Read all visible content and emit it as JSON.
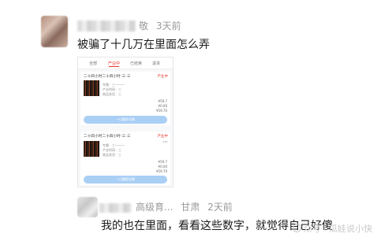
{
  "comment1": {
    "user_suffix": "敬",
    "time": "3天前",
    "text": "被骗了十几万在里面怎么弄"
  },
  "screenshot": {
    "tabs": [
      "全部",
      "产业中",
      "已结束",
      "退货"
    ],
    "orders": [
      {
        "name": "二十四小时二十四小时·三·三",
        "status": "产业中",
        "lines": [
          "专属 · 三一一一",
          "产业时间 · 三",
          "商品发货 · 三"
        ],
        "amounts": [
          "¥59.7",
          "¥0.00",
          "¥59.70"
        ],
        "track_label": "一日跟踪详情"
      },
      {
        "name": "二十四小时二十四小时·三·三",
        "status": "产业中",
        "lines": [
          "专属 · 三一一一",
          "产业时间 · 三",
          "商品发货 · 三"
        ],
        "amounts": [
          "¥59.7",
          "¥0.00",
          "¥59.70"
        ],
        "track_label": "一日跟踪详情"
      }
    ]
  },
  "comment2": {
    "user": "高级育...",
    "location": "甘肃",
    "time": "2天前",
    "text": "我的也在里面，看看这些数字，就觉得自己好傻"
  },
  "watermark": "众号 · 瓜娃说小快"
}
